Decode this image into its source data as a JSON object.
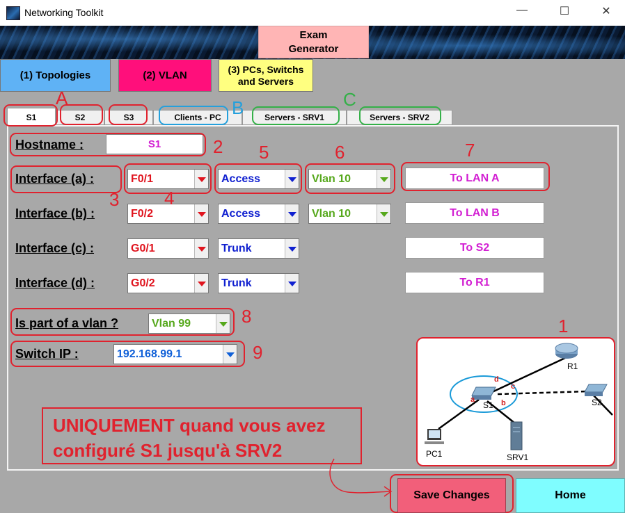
{
  "window": {
    "title": "Networking Toolkit",
    "minimize": "—",
    "maximize": "☐",
    "close": "✕"
  },
  "header": {
    "exam_generator": "Exam\nGenerator"
  },
  "nav": {
    "topologies": "(1) Topologies",
    "vlan": "(2) VLAN",
    "pcs_switches": "(3) PCs, Switchs and Servers"
  },
  "tabs": [
    "S1",
    "S2",
    "S3",
    "Clients - PC",
    "Servers - SRV1",
    "Servers - SRV2"
  ],
  "form": {
    "hostname_label": "Hostname :",
    "hostname_value": "S1",
    "interfaces": [
      {
        "label": "Interface (a) :",
        "port": "F0/1",
        "mode": "Access",
        "vlan": "Vlan 10",
        "description": "To LAN A"
      },
      {
        "label": "Interface (b) :",
        "port": "F0/2",
        "mode": "Access",
        "vlan": "Vlan 10",
        "description": "To LAN B"
      },
      {
        "label": "Interface (c) :",
        "port": "G0/1",
        "mode": "Trunk",
        "vlan": "",
        "description": "To S2"
      },
      {
        "label": "Interface (d) :",
        "port": "G0/2",
        "mode": "Trunk",
        "vlan": "",
        "description": "To R1"
      }
    ],
    "vlan_member_label": "Is part of a vlan ?",
    "vlan_member_value": "Vlan 99",
    "switch_ip_label": "Switch IP :",
    "switch_ip_value": "192.168.99.1"
  },
  "annotations": {
    "letters": [
      "A",
      "B",
      "C"
    ],
    "numbers": [
      "1",
      "2",
      "3",
      "4",
      "5",
      "6",
      "7",
      "8",
      "9"
    ],
    "note": "UNIQUEMENT quand vous avez configuré S1 jusqu'à SRV2"
  },
  "topology": {
    "devices": [
      "R1",
      "S1",
      "S2",
      "PC1",
      "SRV1"
    ],
    "links": [
      "a",
      "b",
      "c",
      "d"
    ]
  },
  "footer": {
    "save": "Save Changes",
    "home": "Home"
  },
  "colors": {
    "vlan_btn": "#ff0f7b",
    "topologies_btn": "#5fb2f5",
    "pcs_btn": "#ffff80",
    "annotation_red": "#e0222e",
    "annotation_blue": "#25a0dc",
    "annotation_green": "#34b048"
  }
}
